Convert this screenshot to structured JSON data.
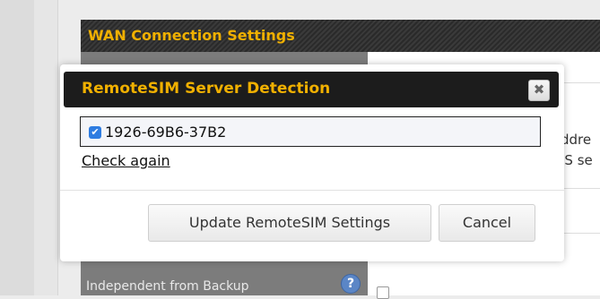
{
  "background": {
    "section_title": "WAN Connection Settings",
    "fragment_line1": "ddre",
    "fragment_line2": "IS se",
    "independent_label": "Independent from Backup",
    "help_glyph": "?"
  },
  "dialog": {
    "title": "RemoteSIM Server Detection",
    "close_glyph": "✖",
    "server_item": {
      "label": "1926-69B6-37B2",
      "checked": true
    },
    "check_again_label": "Check again",
    "buttons": {
      "update_label": "Update RemoteSIM Settings",
      "cancel_label": "Cancel"
    }
  },
  "colors": {
    "accent": "#f0b000",
    "header_bg": "#1c1c1c",
    "checkbox": "#2f7de1"
  }
}
